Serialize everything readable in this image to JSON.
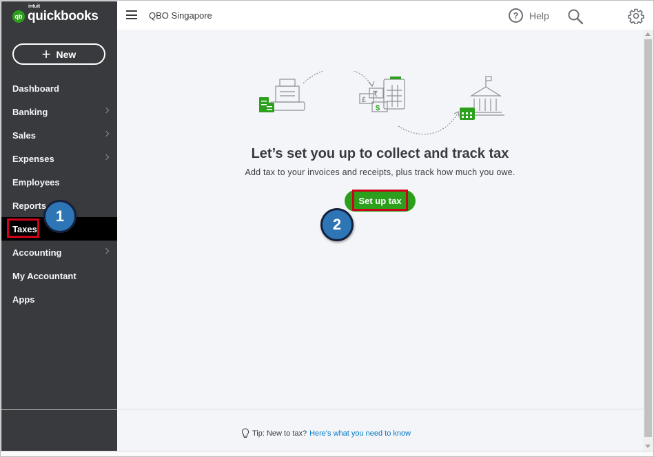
{
  "brand": {
    "mark": "qb",
    "small": "intuit",
    "name": "quickbooks"
  },
  "sidebar": {
    "new_label": "New",
    "items": [
      {
        "label": "Dashboard",
        "chevron": false
      },
      {
        "label": "Banking",
        "chevron": true
      },
      {
        "label": "Sales",
        "chevron": true
      },
      {
        "label": "Expenses",
        "chevron": true
      },
      {
        "label": "Employees",
        "chevron": false
      },
      {
        "label": "Reports",
        "chevron": false
      },
      {
        "label": "Taxes",
        "chevron": false,
        "active": true
      },
      {
        "label": "Accounting",
        "chevron": true
      },
      {
        "label": "My Accountant",
        "chevron": false
      },
      {
        "label": "Apps",
        "chevron": false
      }
    ]
  },
  "header": {
    "company": "QBO Singapore",
    "help_label": "Help",
    "help_glyph": "?"
  },
  "main": {
    "headline": "Let’s set you up to collect and track tax",
    "subline": "Add tax to your invoices and receipts, plus track how much you owe.",
    "cta_label": "Set up tax",
    "tip_prefix": "Tip: New to tax?",
    "tip_link": "Here's what you need to know"
  },
  "illustration": {
    "currency_1": "₹",
    "currency_2": "£",
    "currency_3": "$"
  },
  "callouts": {
    "first": "1",
    "second": "2"
  },
  "colors": {
    "sidebar_bg": "#393a3d",
    "active_item_bg": "#000000",
    "brand_green": "#2ca01c",
    "link_blue": "#0077c5",
    "callout_blue": "#2e75b6",
    "highlight_red": "#d0021b",
    "main_bg": "#f4f5f8"
  },
  "icons": [
    "menu-icon",
    "help-icon",
    "search-icon",
    "gear-icon",
    "lightbulb-icon",
    "chevron-right-icon",
    "plus-icon"
  ]
}
